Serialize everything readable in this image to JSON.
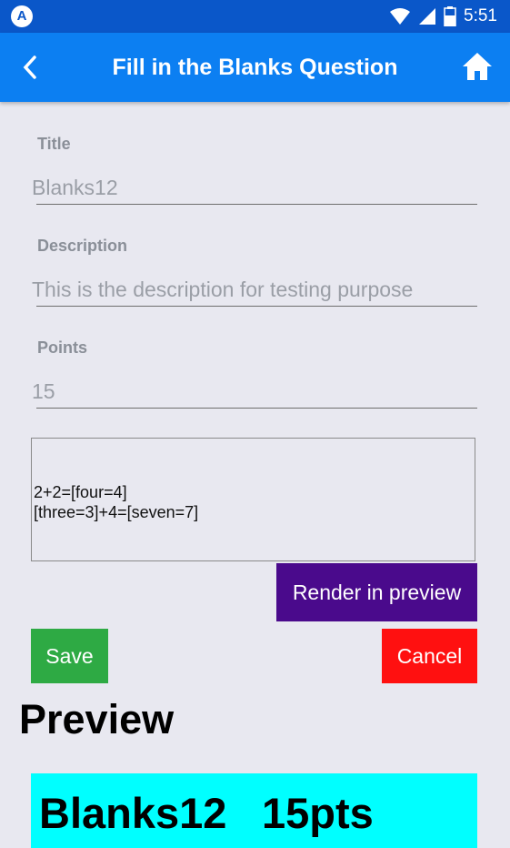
{
  "status_bar": {
    "app_icon": "A",
    "time": "5:51",
    "icons": [
      "wifi-icon",
      "signal-icon",
      "battery-icon"
    ],
    "color": "#0a57c9"
  },
  "app_bar": {
    "title": "Fill in the Blanks Question",
    "back_icon": "chevron-left-icon",
    "home_icon": "home-icon",
    "color": "#0c7ff2"
  },
  "form": {
    "title": {
      "label": "Title",
      "value": "Blanks12"
    },
    "description": {
      "label": "Description",
      "value": "This is the description for testing purpose"
    },
    "points": {
      "label": "Points",
      "value": "15"
    },
    "blanks_text": "2+2=[four=4]\n[three=3]+4=[seven=7]"
  },
  "buttons": {
    "render": {
      "label": "Render in preview",
      "color": "#4a0a8c"
    },
    "save": {
      "label": "Save",
      "color": "#2eaa44"
    },
    "cancel": {
      "label": "Cancel",
      "color": "#ff1010"
    }
  },
  "preview": {
    "heading": "Preview",
    "title": "Blanks12",
    "points_text": "15pts",
    "color": "#00ffff"
  }
}
